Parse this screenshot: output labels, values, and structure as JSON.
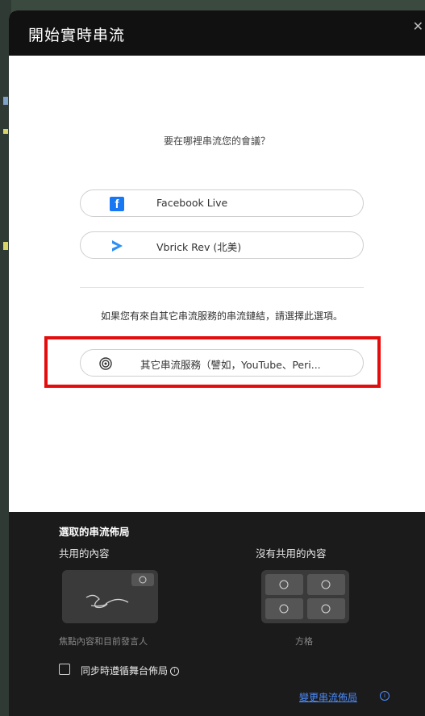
{
  "dialog": {
    "title": "開始實時串流",
    "close_icon": "close-icon"
  },
  "prompt": {
    "question": "要在哪裡串流您的會議？"
  },
  "services": [
    {
      "label": "Facebook Live",
      "icon": "facebook-icon",
      "color": "#1877f2"
    },
    {
      "label": "Vbrick Rev (北美)",
      "icon": "vbrick-play-icon",
      "color": "#2f8ff0"
    }
  ],
  "other": {
    "note": "如果您有來自其它串流服務的串流鏈結，請選擇此選項。",
    "label": "其它串流服務（譬如，YouTube、Peri...",
    "icon": "broadcast-icon"
  },
  "layout": {
    "title": "選取的串流佈局",
    "shared_label": "共用的內容",
    "shared_sub": "焦點內容和目前發言人",
    "no_shared_label": "沒有共用的內容",
    "no_shared_sub": "方格",
    "checkbox_label": "同步時遵循舞台佈局",
    "change_link": "變更串流佈局"
  },
  "colors": {
    "header_bg": "#111111",
    "footer_bg": "#1b1b1b",
    "highlight": "#e40d0d",
    "link": "#4c8dff"
  }
}
